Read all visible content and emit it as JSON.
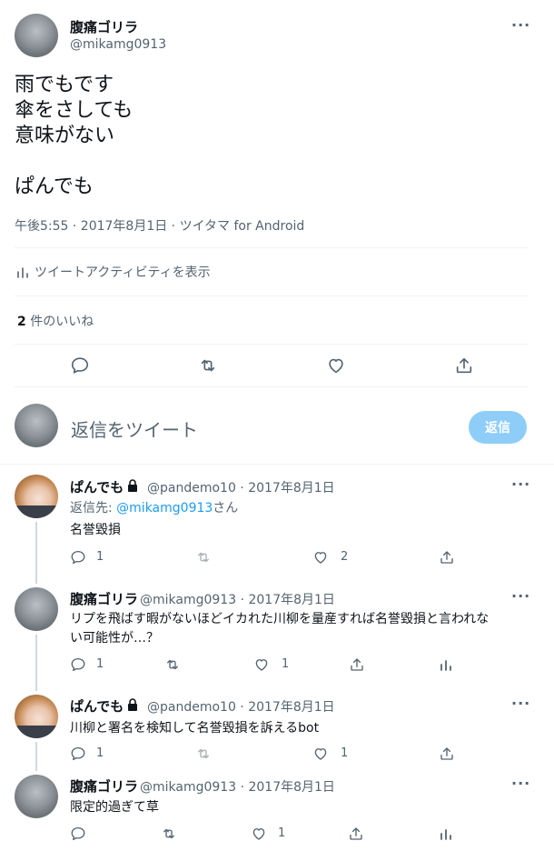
{
  "main_tweet": {
    "display_name": "腹痛ゴリラ",
    "handle": "@mikamg0913",
    "lines": [
      "雨でもです",
      "傘をさしても",
      "意味がない",
      "ぱんでも"
    ],
    "meta": "午後5:55 · 2017年8月1日 · ツイタマ for Android",
    "activity_label": "ツイートアクティビティを表示",
    "likes_count": "2",
    "likes_label": " 件のいいね"
  },
  "reply_box": {
    "placeholder": "返信をツイート",
    "button_label": "返信"
  },
  "replies": [
    {
      "display_name": "ぱんでも",
      "handle_date": "@pandemo10 · 2017年8月1日",
      "reply_to_prefix": "返信先: ",
      "reply_to_handle": "@mikamg0913",
      "reply_to_suffix": "さん",
      "text": "名誉毀損",
      "reply_count": "1",
      "like_count": "2"
    },
    {
      "display_name": "腹痛ゴリラ",
      "handle_date": "@mikamg0913 · 2017年8月1日",
      "text_line1": "リプを飛ばす暇がないほどイカれた川柳を量産すれば名誉毀損と言われな",
      "text_line2": "い可能性が…？",
      "reply_count": "1",
      "like_count": "1"
    },
    {
      "display_name": "ぱんでも",
      "handle_date": "@pandemo10 · 2017年8月1日",
      "text": "川柳と署名を検知して名誉毀損を訴えるbot",
      "reply_count": "1",
      "like_count": "1"
    },
    {
      "display_name": "腹痛ゴリラ",
      "handle_date": "@mikamg0913 · 2017年8月1日",
      "text": "限定的過ぎて草",
      "like_count": "1"
    }
  ],
  "icons": {
    "more": "more-icon",
    "reply": "reply-icon",
    "retweet": "retweet-icon",
    "like": "heart-icon",
    "share": "share-icon",
    "analytics": "analytics-icon",
    "lock": "lock-icon"
  },
  "colors": {
    "accent": "#1d9bf0",
    "reply_button_disabled": "#8ecdf8",
    "text": "#0f1419",
    "muted": "#536471"
  }
}
